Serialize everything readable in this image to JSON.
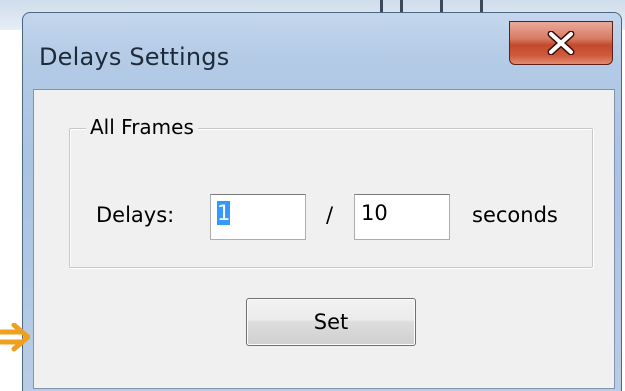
{
  "dialog": {
    "title": "Delays Settings",
    "close_label": "X"
  },
  "group": {
    "legend": "All Frames"
  },
  "fields": {
    "delays_label": "Delays:",
    "numerator_value": "1",
    "separator": "/",
    "denominator_value": "10",
    "unit_label": "seconds"
  },
  "actions": {
    "set_label": "Set"
  },
  "colors": {
    "selection": "#3399ff",
    "close_button": "#c3492d",
    "arrow": "#f5a623",
    "client_bg": "#f0f0f0"
  },
  "icons": {
    "close": "close-icon",
    "pointer": "arrow-icon"
  }
}
